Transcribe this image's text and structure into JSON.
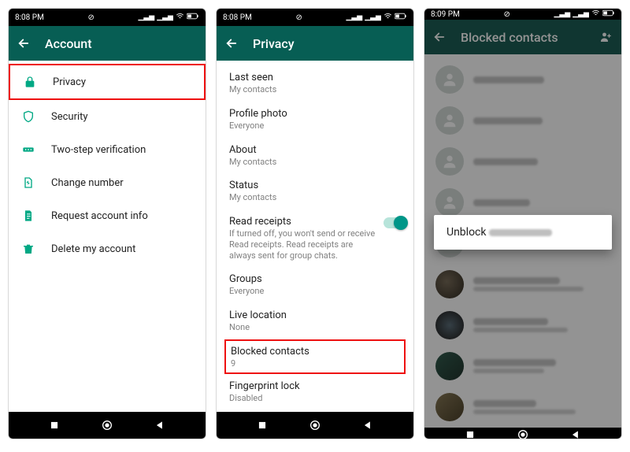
{
  "status": {
    "time_a": "8:08 PM",
    "time_b": "8:08 PM",
    "time_c": "8:09 PM"
  },
  "screen1": {
    "title": "Account",
    "items": [
      {
        "label": "Privacy",
        "highlight": true
      },
      {
        "label": "Security"
      },
      {
        "label": "Two-step verification"
      },
      {
        "label": "Change number"
      },
      {
        "label": "Request account info"
      },
      {
        "label": "Delete my account"
      }
    ]
  },
  "screen2": {
    "title": "Privacy",
    "items": [
      {
        "title": "Last seen",
        "desc": "My contacts"
      },
      {
        "title": "Profile photo",
        "desc": "Everyone"
      },
      {
        "title": "About",
        "desc": "My contacts"
      },
      {
        "title": "Status",
        "desc": "My contacts"
      },
      {
        "title": "Read receipts",
        "desc": "If turned off, you won't send or receive Read receipts. Read receipts are always sent for group chats.",
        "toggle": true
      },
      {
        "title": "Groups",
        "desc": "Everyone"
      },
      {
        "title": "Live location",
        "desc": "None"
      },
      {
        "title": "Blocked contacts",
        "desc": "9",
        "highlight": true
      },
      {
        "title": "Fingerprint lock",
        "desc": "Disabled"
      }
    ]
  },
  "screen3": {
    "title": "Blocked contacts",
    "popup_label": "Unblock",
    "blocked_count": 9
  },
  "colors": {
    "brand": "#075e54",
    "accent": "#009688",
    "highlight": "#e11"
  }
}
